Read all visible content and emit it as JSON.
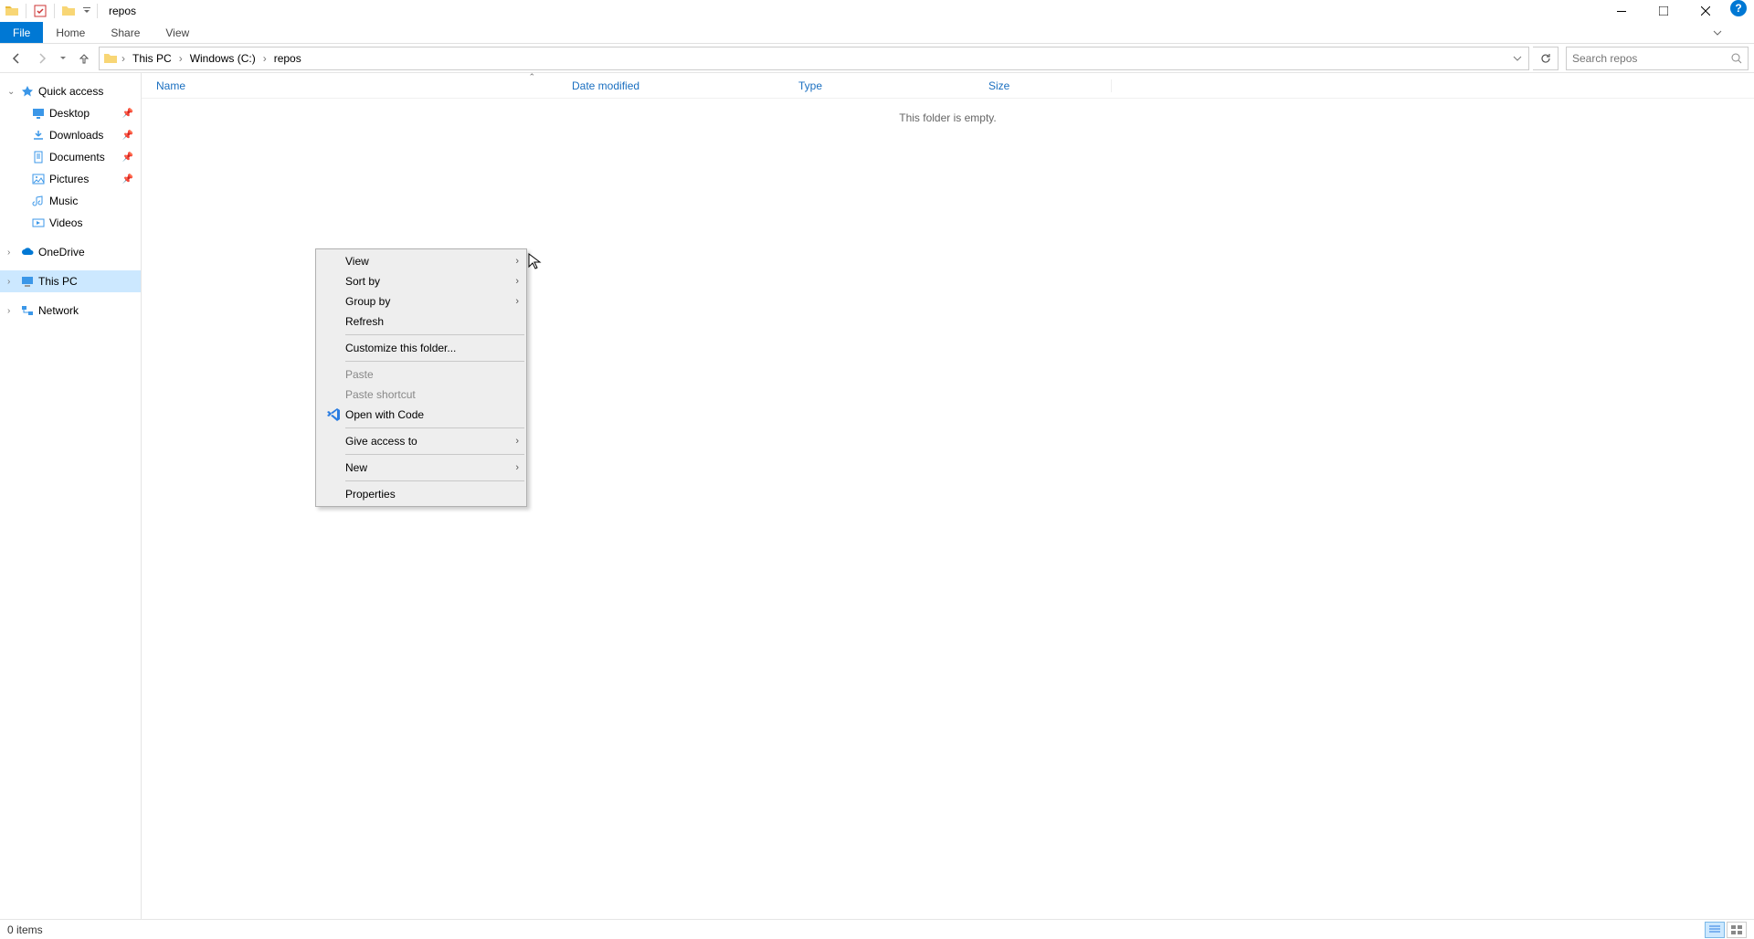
{
  "title": "repos",
  "ribbon": {
    "file": "File",
    "home": "Home",
    "share": "Share",
    "view": "View"
  },
  "breadcrumb": {
    "pc": "This PC",
    "drive": "Windows (C:)",
    "folder": "repos"
  },
  "search": {
    "placeholder": "Search repos"
  },
  "sidebar": {
    "quick_access": "Quick access",
    "items": [
      {
        "label": "Desktop",
        "icon": "desktop"
      },
      {
        "label": "Downloads",
        "icon": "downloads"
      },
      {
        "label": "Documents",
        "icon": "documents"
      },
      {
        "label": "Pictures",
        "icon": "pictures"
      },
      {
        "label": "Music",
        "icon": "music"
      },
      {
        "label": "Videos",
        "icon": "videos"
      }
    ],
    "onedrive": "OneDrive",
    "this_pc": "This PC",
    "network": "Network"
  },
  "columns": {
    "name": "Name",
    "date": "Date modified",
    "type": "Type",
    "size": "Size"
  },
  "empty_text": "This folder is empty.",
  "context_menu": {
    "view": "View",
    "sort_by": "Sort by",
    "group_by": "Group by",
    "refresh": "Refresh",
    "customize": "Customize this folder...",
    "paste": "Paste",
    "paste_shortcut": "Paste shortcut",
    "open_with_code": "Open with Code",
    "give_access_to": "Give access to",
    "new": "New",
    "properties": "Properties"
  },
  "status": {
    "items": "0 items"
  }
}
